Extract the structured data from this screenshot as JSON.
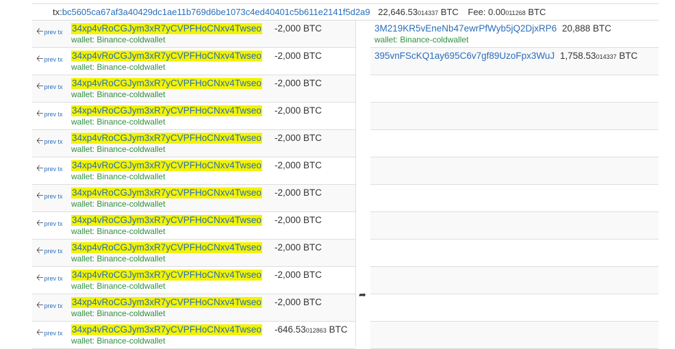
{
  "tx": {
    "label": "tx:",
    "hash": "bc5605ca67af3a40429dc1ae11b769d6be1073c4ed40401c5b611e2141f5d2a9",
    "total_main": "22,646.53",
    "total_small": "014337",
    "total_unit": "BTC",
    "fee_label": "Fee: ",
    "fee_main": "0.00",
    "fee_small": "011268",
    "fee_unit": "BTC"
  },
  "prev_label": "prev tx",
  "inputs": [
    {
      "address": "34xp4vRoCGJym3xR7yCVPFHoCNxv4Twseo",
      "amount": "-2,000 BTC",
      "amount_small": "",
      "amount_unit": "",
      "wallet": "wallet: Binance-coldwallet"
    },
    {
      "address": "34xp4vRoCGJym3xR7yCVPFHoCNxv4Twseo",
      "amount": "-2,000 BTC",
      "amount_small": "",
      "amount_unit": "",
      "wallet": "wallet: Binance-coldwallet"
    },
    {
      "address": "34xp4vRoCGJym3xR7yCVPFHoCNxv4Twseo",
      "amount": "-2,000 BTC",
      "amount_small": "",
      "amount_unit": "",
      "wallet": "wallet: Binance-coldwallet"
    },
    {
      "address": "34xp4vRoCGJym3xR7yCVPFHoCNxv4Twseo",
      "amount": "-2,000 BTC",
      "amount_small": "",
      "amount_unit": "",
      "wallet": "wallet: Binance-coldwallet"
    },
    {
      "address": "34xp4vRoCGJym3xR7yCVPFHoCNxv4Twseo",
      "amount": "-2,000 BTC",
      "amount_small": "",
      "amount_unit": "",
      "wallet": "wallet: Binance-coldwallet"
    },
    {
      "address": "34xp4vRoCGJym3xR7yCVPFHoCNxv4Twseo",
      "amount": "-2,000 BTC",
      "amount_small": "",
      "amount_unit": "",
      "wallet": "wallet: Binance-coldwallet"
    },
    {
      "address": "34xp4vRoCGJym3xR7yCVPFHoCNxv4Twseo",
      "amount": "-2,000 BTC",
      "amount_small": "",
      "amount_unit": "",
      "wallet": "wallet: Binance-coldwallet"
    },
    {
      "address": "34xp4vRoCGJym3xR7yCVPFHoCNxv4Twseo",
      "amount": "-2,000 BTC",
      "amount_small": "",
      "amount_unit": "",
      "wallet": "wallet: Binance-coldwallet"
    },
    {
      "address": "34xp4vRoCGJym3xR7yCVPFHoCNxv4Twseo",
      "amount": "-2,000 BTC",
      "amount_small": "",
      "amount_unit": "",
      "wallet": "wallet: Binance-coldwallet"
    },
    {
      "address": "34xp4vRoCGJym3xR7yCVPFHoCNxv4Twseo",
      "amount": "-2,000 BTC",
      "amount_small": "",
      "amount_unit": "",
      "wallet": "wallet: Binance-coldwallet"
    },
    {
      "address": "34xp4vRoCGJym3xR7yCVPFHoCNxv4Twseo",
      "amount": "-2,000 BTC",
      "amount_small": "",
      "amount_unit": "",
      "wallet": "wallet: Binance-coldwallet"
    },
    {
      "address": "34xp4vRoCGJym3xR7yCVPFHoCNxv4Twseo",
      "amount": "-646.53",
      "amount_small": "012863",
      "amount_unit": " BTC",
      "wallet": "wallet: Binance-coldwallet"
    }
  ],
  "outputs": [
    {
      "address": "3M219KR5vEneNb47ewrPfWyb5jQ2DjxRP6",
      "amount": "20,888 BTC",
      "amount_small": "",
      "amount_unit": "",
      "wallet": "wallet: Binance-coldwallet"
    },
    {
      "address": "395vnFScKQ1ay695C6v7gf89UzoFpx3WuJ",
      "amount": "1,758.53",
      "amount_small": "014337",
      "amount_unit": " BTC",
      "wallet": ""
    }
  ],
  "empty_output_rows": 10,
  "icons": {
    "prev": "left-arrow-icon",
    "flow": "share-arrow-icon"
  },
  "colors": {
    "highlight": "#f3f300",
    "link": "#2a6ebb",
    "wallet": "#2f8f3f",
    "row_alt": "#f9f9f9"
  }
}
